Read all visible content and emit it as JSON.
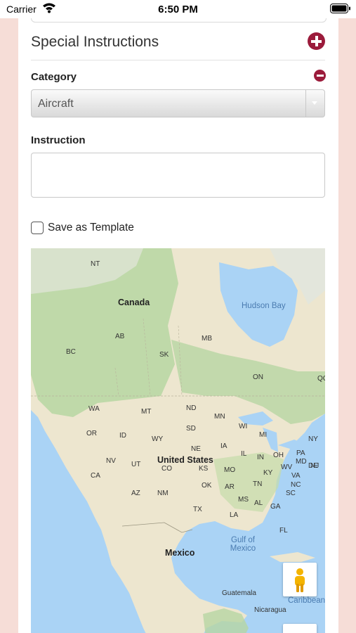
{
  "status_bar": {
    "carrier": "Carrier",
    "time": "6:50 PM",
    "icons": [
      "wifi-icon",
      "battery-icon"
    ]
  },
  "section": {
    "title": "Special Instructions",
    "add_icon": "plus-circle-icon"
  },
  "category": {
    "label": "Category",
    "remove_icon": "minus-circle-icon",
    "selected_value": "Aircraft"
  },
  "instruction": {
    "label": "Instruction",
    "value": ""
  },
  "template_option": {
    "label": "Save as Template",
    "checked": false
  },
  "map": {
    "countries": [
      "Canada",
      "United States",
      "Mexico"
    ],
    "water": [
      "Hudson Bay",
      "Gulf of Mexico",
      "Caribbean"
    ],
    "regions": [
      "NT",
      "AB",
      "BC",
      "SK",
      "MB",
      "ON",
      "QC",
      "WA",
      "MT",
      "ND",
      "MN",
      "OR",
      "ID",
      "WY",
      "SD",
      "WI",
      "MI",
      "NY",
      "NE",
      "IA",
      "IL",
      "IN",
      "OH",
      "PA",
      "NV",
      "UT",
      "CO",
      "KS",
      "MO",
      "KY",
      "WV",
      "VA",
      "CA",
      "OK",
      "AR",
      "TN",
      "NC",
      "AZ",
      "NM",
      "MS",
      "AL",
      "GA",
      "SC",
      "TX",
      "LA",
      "FL",
      "MD",
      "DE",
      "NJ"
    ],
    "cities": [
      "Guatemala",
      "Nicaragua"
    ],
    "controls": [
      "pegman-icon"
    ]
  },
  "colors": {
    "accent": "#9b1b3b",
    "background": "#f6ddd7",
    "water": "#aad3f5",
    "land": "#ede6cf",
    "forest": "#b6d6a2"
  }
}
